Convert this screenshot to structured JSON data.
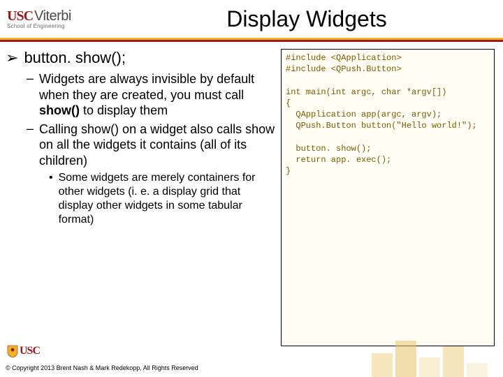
{
  "header": {
    "logo_usc": "USC",
    "logo_viterbi": "Viterbi",
    "logo_sub": "School of Engineering",
    "title": "Display Widgets"
  },
  "bullets": {
    "lvl1": "button. show();",
    "lvl2a_pre": "Widgets are always invisible by default when they are created, you must call ",
    "lvl2a_bold": "show()",
    "lvl2a_post": " to display them",
    "lvl2b": "Calling show() on a widget also calls show on all the widgets it contains (all of its children)",
    "lvl3": "Some widgets are merely containers for other widgets (i. e. a display grid that display other widgets in some tabular format)"
  },
  "code": "#include <QApplication>\n#include <QPush.Button>\n\nint main(int argc, char *argv[])\n{\n  QApplication app(argc, argv);\n  QPush.Button button(\"Hello world!\");\n\n  button. show();\n  return app. exec();\n}",
  "footer": {
    "usc": "USC",
    "copyright": "© Copyright 2013 Brent Nash & Mark Redekopp, All Rights Reserved"
  }
}
